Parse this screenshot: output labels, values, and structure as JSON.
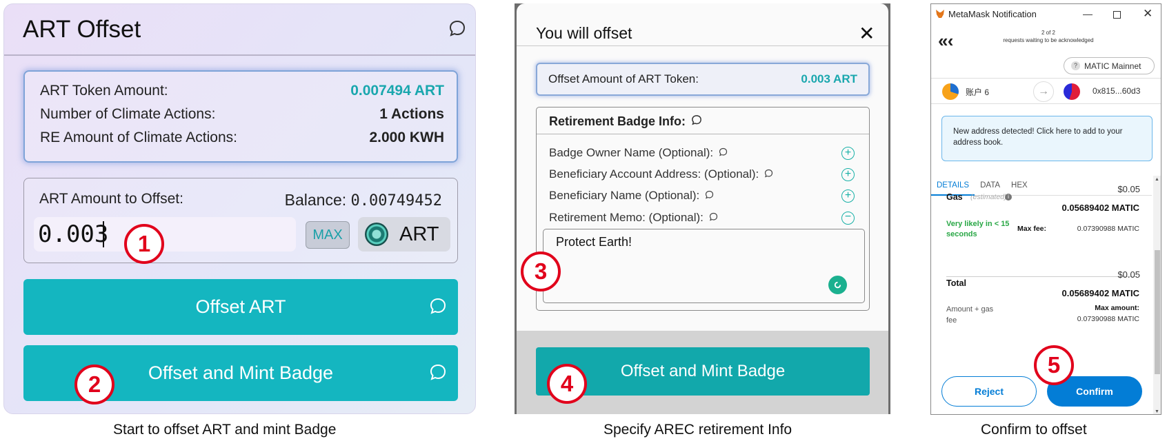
{
  "panel1": {
    "title": "ART Offset",
    "token_amount_label": "ART Token Amount:",
    "token_amount_value": "0.007494 ART",
    "actions_label": "Number of Climate Actions:",
    "actions_value": "1 Actions",
    "re_amount_label": "RE Amount of Climate Actions:",
    "re_amount_value": "2.000 KWH",
    "amount_label": "ART Amount to Offset:",
    "balance_label": "Balance:",
    "balance_value": "0.00749452",
    "amount_input": "0.003",
    "max_label": "MAX",
    "token_label": "ART",
    "offset_button": "Offset ART",
    "mint_button": "Offset and Mint Badge",
    "caption": "Start to offset ART and  mint Badge"
  },
  "panel2": {
    "title": "You will offset",
    "close": "✕",
    "offset_label": "Offset Amount of ART Token:",
    "offset_value": "0.003 ART",
    "badge_header": "Retirement Badge Info:",
    "fields": [
      "Badge Owner Name (Optional):",
      "Beneficiary Account Address: (Optional):",
      "Beneficiary Name (Optional):",
      "Retirement Memo: (Optional):"
    ],
    "memo_value": "Protect Earth!",
    "mint_button": "Offset and Mint Badge",
    "caption": "Specify AREC retirement Info"
  },
  "panel3": {
    "window_title": "MetaMask Notification",
    "nav_count": "2 of 2",
    "nav_sub": "requests waiting to be acknowledged",
    "network": "MATIC Mainnet",
    "account_from": "账户 6",
    "account_to": "0x815...60d3",
    "notice": "New address detected! Click here to add to your address book.",
    "tabs": [
      "DETAILS",
      "DATA",
      "HEX"
    ],
    "gas_usd": "$0.05",
    "gas_label": "Gas",
    "gas_estimated": "(estimated)",
    "gas_value": "0.05689402 MATIC",
    "likely": "Very likely in < 15 seconds",
    "max_fee_label": "Max fee:",
    "max_fee_value": "0.07390988 MATIC",
    "total_usd": "$0.05",
    "total_label": "Total",
    "total_value": "0.05689402 MATIC",
    "amount_gas_label": "Amount + gas fee",
    "max_amount_label": "Max amount:",
    "max_amount_value": "0.07390988 MATIC",
    "reject": "Reject",
    "confirm": "Confirm",
    "caption": "Confirm to offset"
  },
  "steps": [
    "1",
    "2",
    "3",
    "4",
    "5"
  ],
  "colors": {
    "teal_button": "#14b6c0",
    "teal_text": "#1aa7ae",
    "step_red": "#e1001b",
    "metamask_blue": "#037dd6",
    "likely_green": "#28a745"
  }
}
